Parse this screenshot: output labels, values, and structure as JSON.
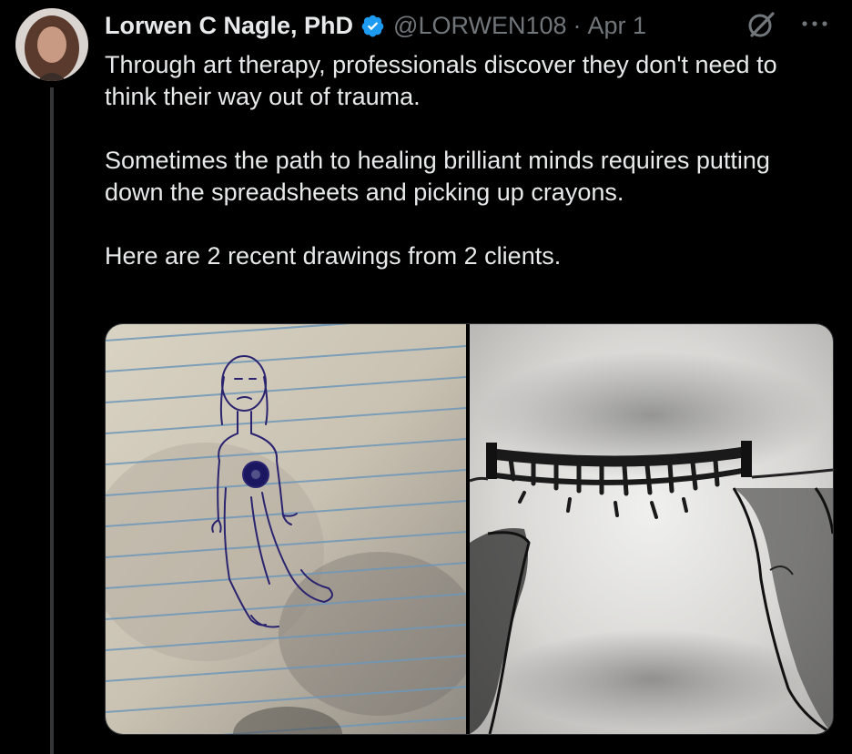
{
  "tweet": {
    "author_name": "Lorwen C Nagle, PhD",
    "handle": "@LORWEN108",
    "separator": "·",
    "date": "Apr 1",
    "text_paragraphs": [
      "Through art therapy, professionals discover they don't need to think their way out of trauma.",
      "Sometimes the path to healing brilliant minds requires putting down the spreadsheets and picking up crayons.",
      "Here are 2 recent drawings from 2 clients."
    ]
  },
  "icons": {
    "verified": "verified-badge-icon",
    "grok": "grok-icon",
    "more": "more-options-icon"
  },
  "colors": {
    "background": "#000000",
    "text": "#e7e9ea",
    "secondary_text": "#71767b",
    "verified_blue": "#1d9bf0"
  }
}
